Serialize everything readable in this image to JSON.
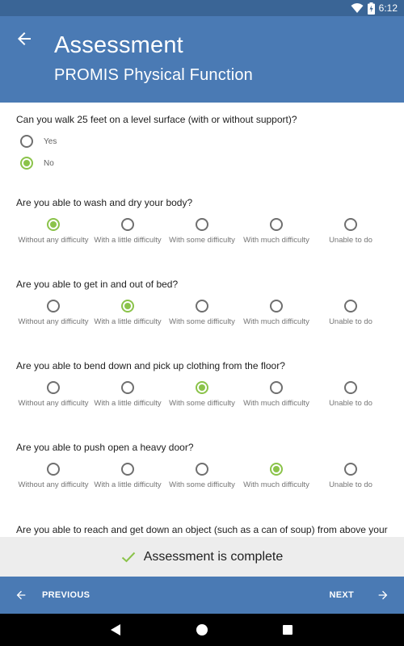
{
  "status_bar": {
    "time": "6:12"
  },
  "header": {
    "title": "Assessment",
    "subtitle": "PROMIS Physical Function"
  },
  "scale_options": [
    "Without any difficulty",
    "With a little difficulty",
    "With some difficulty",
    "With much difficulty",
    "Unable to do"
  ],
  "questions": [
    {
      "text": "Can you walk 25 feet on a level surface (with or without support)?",
      "options": [
        "Yes",
        "No"
      ],
      "selected": "No"
    },
    {
      "text": "Are you able to wash and dry your body?",
      "selected": "Without any difficulty"
    },
    {
      "text": "Are you able to get in and out of bed?",
      "selected": "With a little difficulty"
    },
    {
      "text": "Are you able to bend down and pick up clothing from the floor?",
      "selected": "With some difficulty"
    },
    {
      "text": "Are you able to push open a heavy door?",
      "selected": "With much difficulty"
    },
    {
      "text": "Are you able to reach and get down an object (such as a can of soup) from above your head?"
    }
  ],
  "snackbar": {
    "message": "Assessment is complete"
  },
  "footer": {
    "previous_label": "PREVIOUS",
    "next_label": "NEXT"
  },
  "colors": {
    "app_bar": "#4a7ab4",
    "status_bar": "#3a6596",
    "accent": "#8bc34a"
  }
}
